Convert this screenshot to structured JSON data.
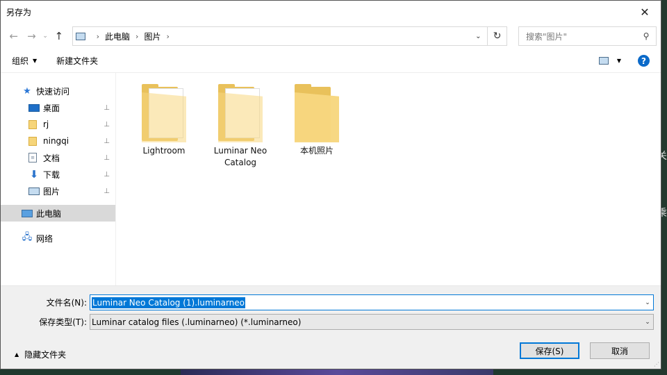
{
  "window": {
    "title": "另存为",
    "close_glyph": "✕"
  },
  "nav": {
    "back_glyph": "←",
    "forward_glyph": "→",
    "dropdown_glyph": "⌄",
    "up_glyph": "↑",
    "breadcrumb": [
      "此电脑",
      "图片"
    ],
    "separator_glyph": "›",
    "address_dropdown_glyph": "⌄",
    "refresh_glyph": "↻",
    "search_placeholder": "搜索\"图片\"",
    "search_icon_glyph": "⚲"
  },
  "toolbar": {
    "organize_label": "组织",
    "organize_caret": "▼",
    "new_folder_label": "新建文件夹",
    "view_caret": "▼",
    "help_glyph": "?"
  },
  "sidebar": {
    "quick_access": "快速访问",
    "pinned": [
      {
        "label": "桌面",
        "icon": "desktop-icon"
      },
      {
        "label": "rj",
        "icon": "folder-icon"
      },
      {
        "label": "ningqi",
        "icon": "folder-icon"
      },
      {
        "label": "文档",
        "icon": "document-icon"
      },
      {
        "label": "下载",
        "icon": "download-icon"
      },
      {
        "label": "图片",
        "icon": "pictures-icon"
      }
    ],
    "pin_glyph": "📌",
    "this_pc": "此电脑",
    "network": "网络"
  },
  "files": [
    {
      "name": "Lightroom",
      "icon": "folder-with-document"
    },
    {
      "name": "Luminar Neo Catalog",
      "icon": "folder-with-document"
    },
    {
      "name": "本机照片",
      "icon": "folder"
    }
  ],
  "form": {
    "filename_label": "文件名(N):",
    "filename_value": "Luminar Neo Catalog (1).luminarneo",
    "type_label": "保存类型(T):",
    "type_value": "Luminar catalog files (.luminarneo)  (*.luminarneo)",
    "dropdown_glyph": "⌄",
    "hide_folders_label": "隐藏文件夹",
    "hide_folders_caret": "▲",
    "save_label": "保存(S)",
    "cancel_label": "取消"
  },
  "background_text": [
    "关",
    "乘"
  ]
}
